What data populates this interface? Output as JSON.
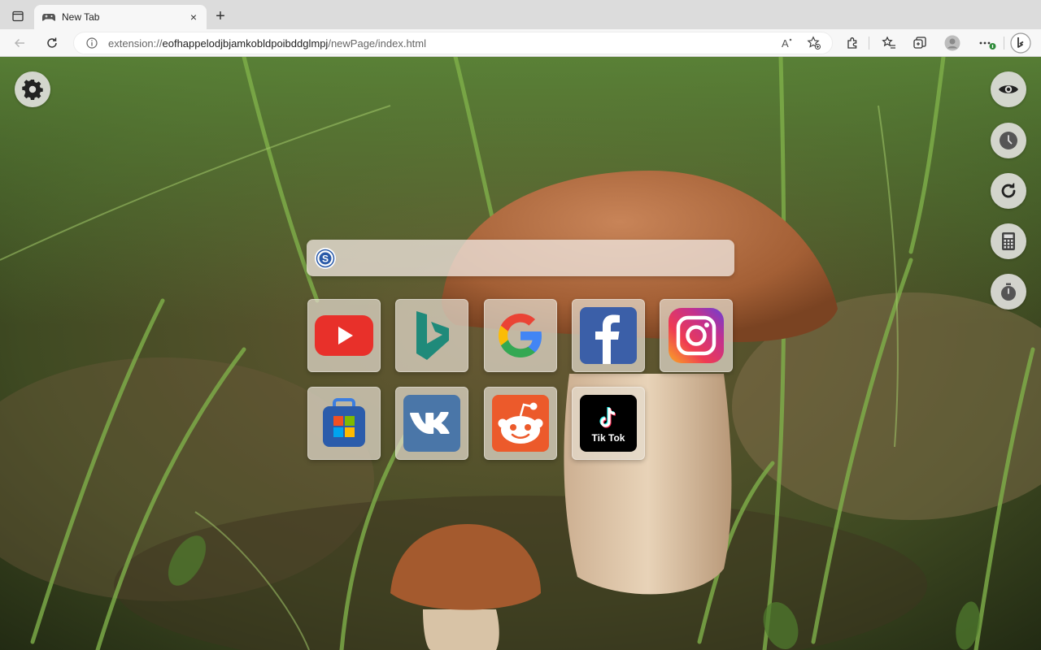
{
  "browser": {
    "tab": {
      "title": "New Tab",
      "close_glyph": "×"
    },
    "new_tab_glyph": "+",
    "address": {
      "url_prefix": "extension://",
      "url_host": "eofhappelodjbjamkobldpoibddglmpj",
      "url_path": "/newPage/index.html"
    }
  },
  "page": {
    "search": {
      "placeholder": "",
      "engine_letter": "S"
    },
    "tiles": [
      {
        "name": "youtube",
        "label": ""
      },
      {
        "name": "bing",
        "label": ""
      },
      {
        "name": "google",
        "label": ""
      },
      {
        "name": "facebook",
        "label": ""
      },
      {
        "name": "instagram",
        "label": ""
      },
      {
        "name": "microsoft-store",
        "label": ""
      },
      {
        "name": "vk",
        "label": ""
      },
      {
        "name": "reddit",
        "label": ""
      },
      {
        "name": "tiktok",
        "label": "Tik Tok"
      }
    ],
    "side_buttons": [
      "eye-icon",
      "clock-icon",
      "refresh-icon",
      "calculator-icon",
      "timer-icon"
    ],
    "settings_icon": "gear-icon"
  },
  "colors": {
    "youtube": "#e8302a",
    "bing": "#1f8a7a",
    "facebook": "#3b5fa8",
    "vk": "#4a76a8",
    "reddit": "#ec5a2b",
    "tiktok": "#000000",
    "store": "#2b5cab"
  }
}
